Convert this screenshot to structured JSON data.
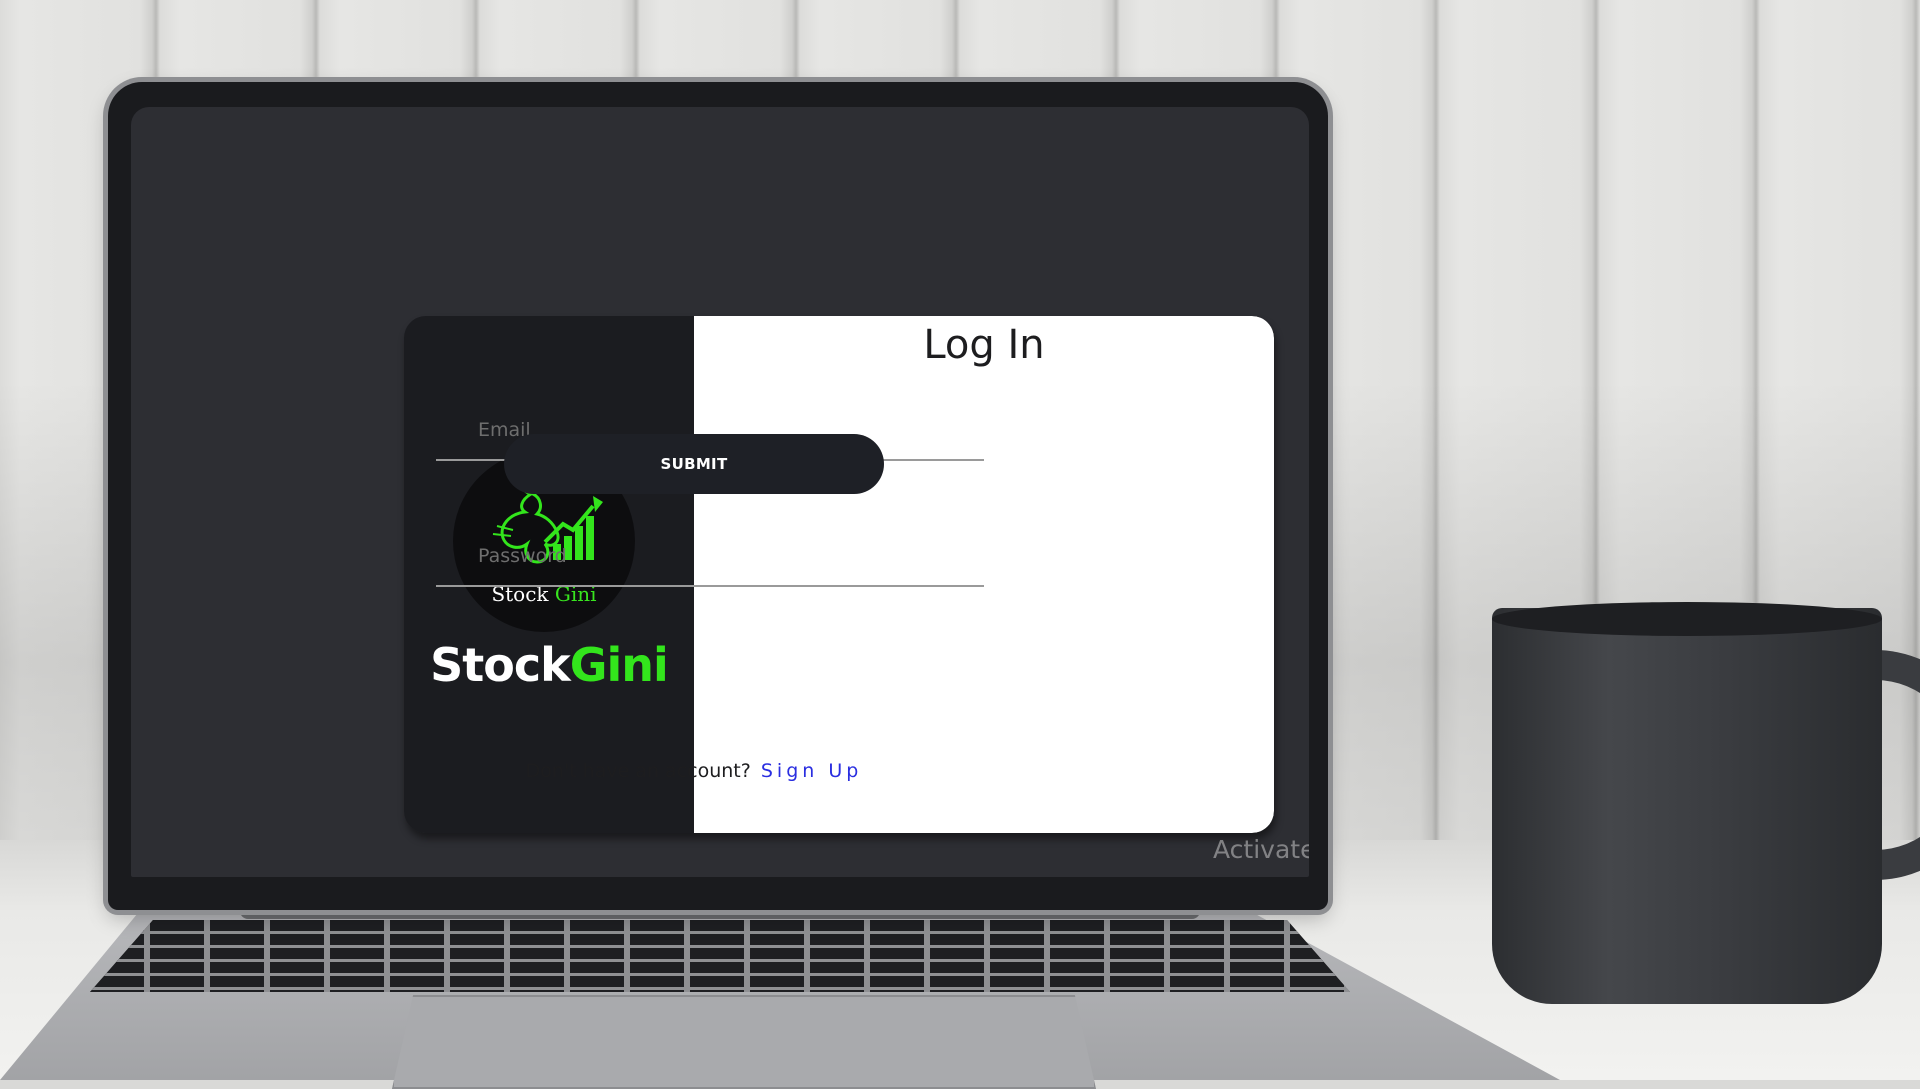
{
  "login": {
    "title": "Log In",
    "email_placeholder": "Email",
    "password_placeholder": "Password",
    "submit_label": "SUBMIT",
    "signup_prompt": "Don't have an account?",
    "signup_link": "Sign Up"
  },
  "brand": {
    "name_part1": "Stock",
    "name_part2": "Gini",
    "logo_text_part1": "Stock",
    "logo_text_part2": "Gini",
    "accent_color": "#33e51c",
    "panel_color": "#1b1c20"
  },
  "os": {
    "watermark": "Activate"
  }
}
